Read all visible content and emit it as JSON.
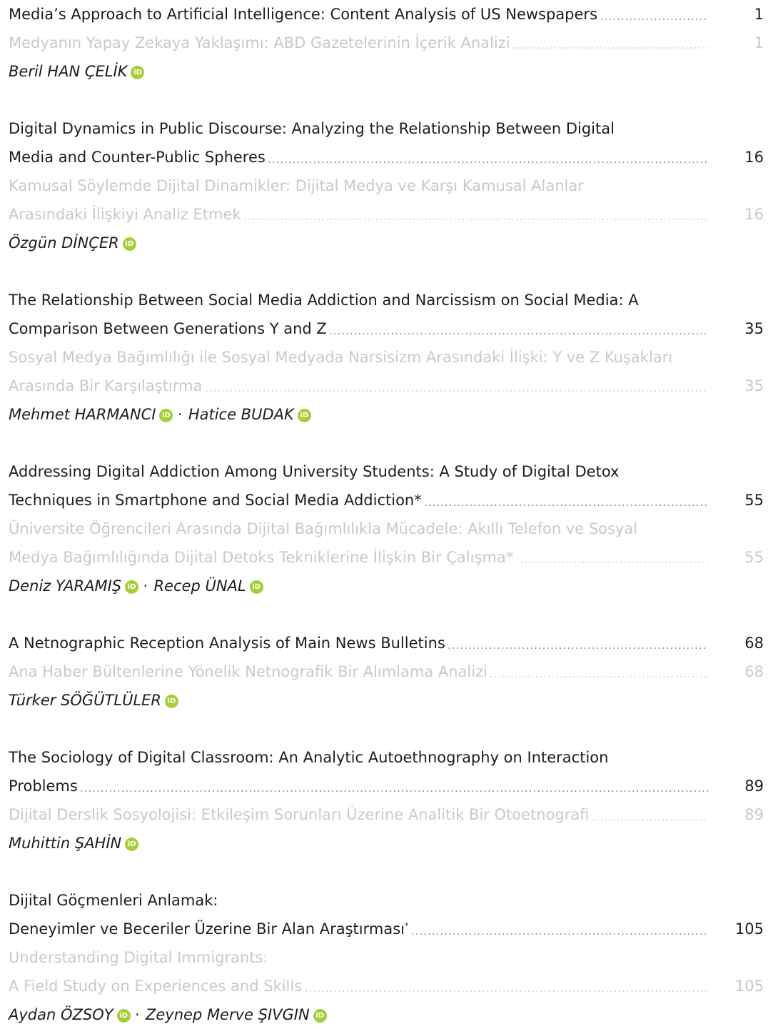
{
  "entries": [
    {
      "title_lines": [
        "Media’s Approach to Artificial Intelligence: Content Analysis of US Newspapers"
      ],
      "page": "1",
      "translation_lines": [
        "Medyanın Yapay Zekaya Yaklaşımı: ABD Gazetelerinin İçerik Analizi"
      ],
      "translation_page": "1",
      "authors": [
        "Beril HAN ÇELİK"
      ]
    },
    {
      "title_lines": [
        "Digital Dynamics in Public Discourse: Analyzing the Relationship Between Digital",
        "Media and Counter-Public Spheres"
      ],
      "page": "16",
      "translation_lines": [
        "Kamusal Söylemde Dijital Dinamikler: Dijital Medya ve Karşı Kamusal Alanlar",
        "Arasındaki İlişkiyi Analiz Etmek"
      ],
      "translation_page": "16",
      "authors": [
        "Özgün DİNÇER"
      ]
    },
    {
      "title_lines": [
        "The Relationship Between Social Media Addiction and Narcissism on Social Media: A",
        "Comparison Between Generations Y and Z"
      ],
      "page": "35",
      "translation_lines": [
        "Sosyal Medya Bağımlılığı ile Sosyal Medyada Narsisizm Arasındaki İlişki: Y ve Z Kuşakları",
        "Arasında Bir Karşılaştırma"
      ],
      "translation_page": "35",
      "authors": [
        "Mehmet HARMANCI",
        "Hatice BUDAK"
      ]
    },
    {
      "title_lines": [
        "Addressing Digital Addiction Among University Students: A Study of Digital Detox",
        "Techniques in Smartphone and Social Media Addiction*"
      ],
      "page": "55",
      "translation_lines": [
        "Üniversite Öğrencileri Arasında Dijital Bağımlılıkla Mücadele: Akıllı Telefon ve Sosyal",
        "Medya Bağımlılığında Dijital Detoks Tekniklerine İlişkin Bir Çalışma*"
      ],
      "translation_page": "55",
      "authors": [
        "Deniz YARAMIŞ",
        "Recep ÜNAL"
      ]
    },
    {
      "title_lines": [
        "A Netnographic Reception Analysis of Main News Bulletins"
      ],
      "page": "68",
      "translation_lines": [
        "Ana Haber Bültenlerine Yönelik Netnografik Bir Alımlama Analizi"
      ],
      "translation_page": "68",
      "authors": [
        "Türker SÖĞÜTLÜLER"
      ]
    },
    {
      "title_lines": [
        "The Sociology of Digital Classroom: An Analytic Autoethnography on Interaction",
        "Problems"
      ],
      "page": "89",
      "translation_lines": [
        "Dijital Derslik Sosyolojisi: Etkileşim Sorunları Üzerine Analitik Bir Otoetnografi"
      ],
      "translation_page": "89",
      "authors": [
        "Muhittin ŞAHİN"
      ]
    },
    {
      "title_lines": [
        "Dijital Göçmenleri Anlamak:",
        "Deneyimler ve Beceriler Üzerine Bir Alan Araştırması*"
      ],
      "page": "105",
      "translation_lines": [
        "Understanding Digital Immigrants:",
        "A Field Study on Experiences and Skills"
      ],
      "translation_page": "105",
      "authors": [
        "Aydan ÖZSOY",
        "Zeynep Merve ŞIVGIN"
      ]
    }
  ],
  "orcid_label": "iD",
  "author_separator": "·",
  "colors": {
    "primary_text": "#1d1d1b",
    "secondary_text": "#c9c9c9",
    "orcid_green": "#a6ce39"
  }
}
